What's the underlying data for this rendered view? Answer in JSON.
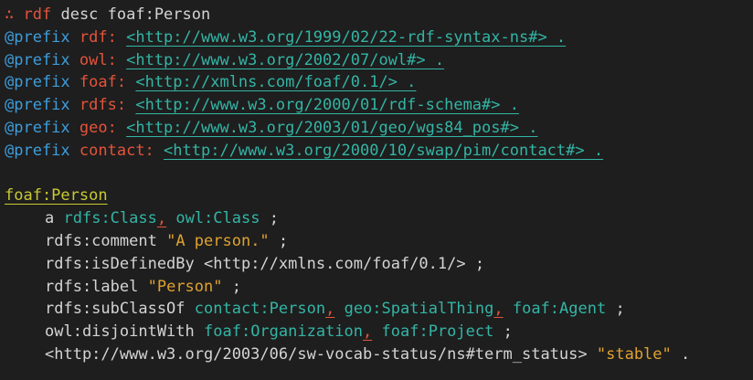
{
  "command": {
    "prompt": "∴",
    "program": "rdf",
    "text": "desc foaf:Person"
  },
  "prefixes": [
    {
      "keyword": "@prefix",
      "name": "rdf:",
      "iri": "<http://www.w3.org/1999/02/22-rdf-syntax-ns#> ."
    },
    {
      "keyword": "@prefix",
      "name": "owl:",
      "iri": "<http://www.w3.org/2002/07/owl#> ."
    },
    {
      "keyword": "@prefix",
      "name": "foaf:",
      "iri": "<http://xmlns.com/foaf/0.1/> ."
    },
    {
      "keyword": "@prefix",
      "name": "rdfs:",
      "iri": "<http://www.w3.org/2000/01/rdf-schema#> ."
    },
    {
      "keyword": "@prefix",
      "name": "geo:",
      "iri": "<http://www.w3.org/2003/01/geo/wgs84_pos#> ."
    },
    {
      "keyword": "@prefix",
      "name": "contact:",
      "iri": "<http://www.w3.org/2000/10/swap/pim/contact#> ."
    }
  ],
  "subject": "foaf:Person",
  "triples": {
    "type": {
      "predicate": "a",
      "obj1": "rdfs:Class",
      "comma": ",",
      "obj2": "owl:Class",
      "end": ";"
    },
    "comment": {
      "predicate": "rdfs:comment",
      "value": "\"A person.\"",
      "end": ";"
    },
    "defined_by": {
      "predicate": "rdfs:isDefinedBy",
      "value": "<http://xmlns.com/foaf/0.1/>",
      "end": ";"
    },
    "label": {
      "predicate": "rdfs:label",
      "value": "\"Person\"",
      "end": ";"
    },
    "subclass": {
      "predicate": "rdfs:subClassOf",
      "obj1": "contact:Person",
      "comma1": ",",
      "obj2": "geo:SpatialThing",
      "comma2": ",",
      "obj3": "foaf:Agent",
      "end": ";"
    },
    "disjoint": {
      "predicate": "owl:disjointWith",
      "obj1": "foaf:Organization",
      "comma": ",",
      "obj2": "foaf:Project",
      "end": ";"
    },
    "status": {
      "predicate": "<http://www.w3.org/2003/06/sw-vocab-status/ns#term_status>",
      "value": "\"stable\"",
      "end": "."
    }
  },
  "colors": {
    "background": "#1e1e1e",
    "text": "#d4d4d4",
    "keyword": "#3e9ddc",
    "prefix_name": "#e5533b",
    "iri": "#33b5a5",
    "subject": "#c9c934",
    "string": "#e0a230"
  }
}
